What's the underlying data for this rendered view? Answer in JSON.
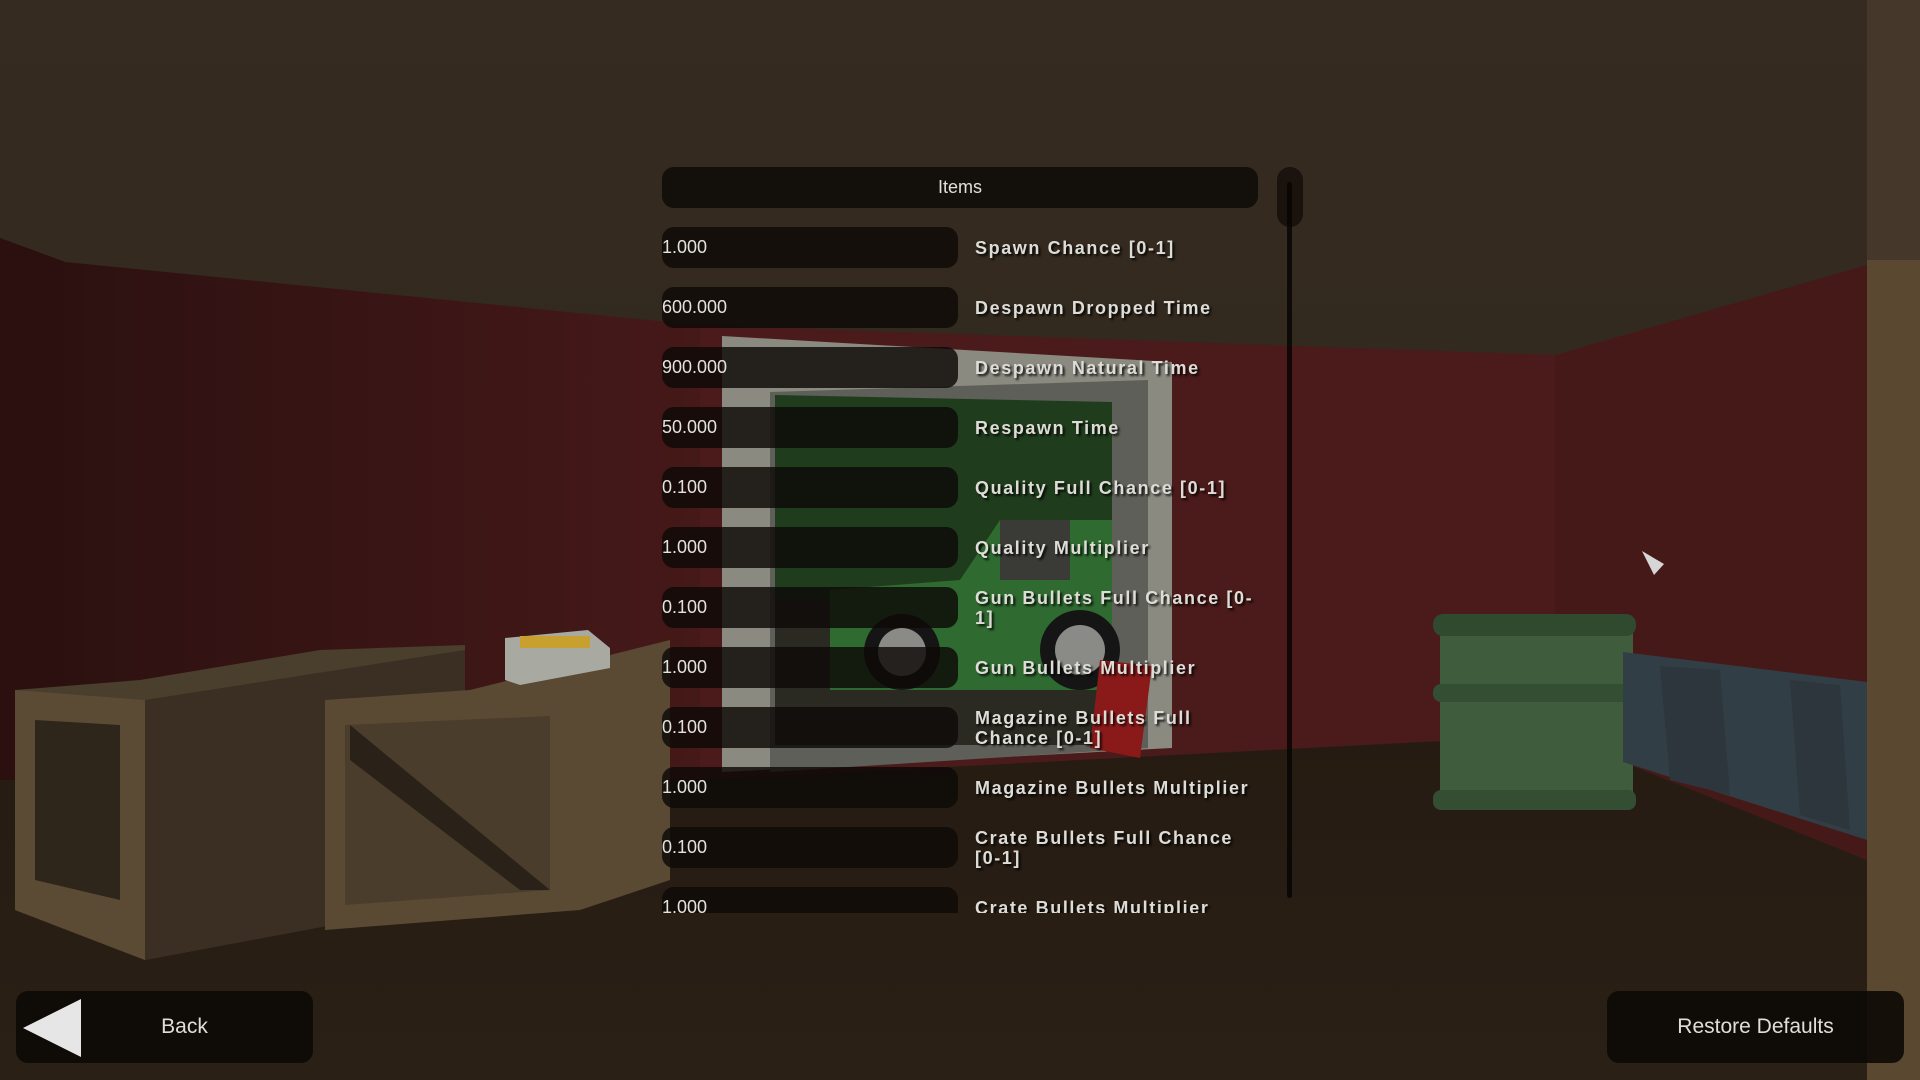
{
  "panel": {
    "header": "Items",
    "rows": [
      {
        "value": "1.000",
        "label": "Spawn Chance [0-1]"
      },
      {
        "value": "600.000",
        "label": "Despawn Dropped Time"
      },
      {
        "value": "900.000",
        "label": "Despawn Natural Time"
      },
      {
        "value": "50.000",
        "label": "Respawn Time"
      },
      {
        "value": "0.100",
        "label": "Quality Full Chance [0-1]"
      },
      {
        "value": "1.000",
        "label": "Quality Multiplier"
      },
      {
        "value": "0.100",
        "label": "Gun Bullets Full Chance [0-1]"
      },
      {
        "value": "1.000",
        "label": "Gun Bullets Multiplier"
      },
      {
        "value": "0.100",
        "label": "Magazine Bullets Full Chance [0-1]"
      },
      {
        "value": "1.000",
        "label": "Magazine Bullets Multiplier"
      },
      {
        "value": "0.100",
        "label": "Crate Bullets Full Chance [0-1]"
      },
      {
        "value": "1.000",
        "label": "Crate Bullets Multiplier"
      }
    ]
  },
  "footer": {
    "back_label": "Back",
    "back_icon": "left-triangle-arrow",
    "restore_label": "Restore Defaults"
  },
  "colors": {
    "panel_bg": "#0e0a07",
    "text": "#e2e0dc",
    "wall": "#4a1a1a",
    "ceiling": "#3a2e22",
    "floor": "#221810"
  }
}
